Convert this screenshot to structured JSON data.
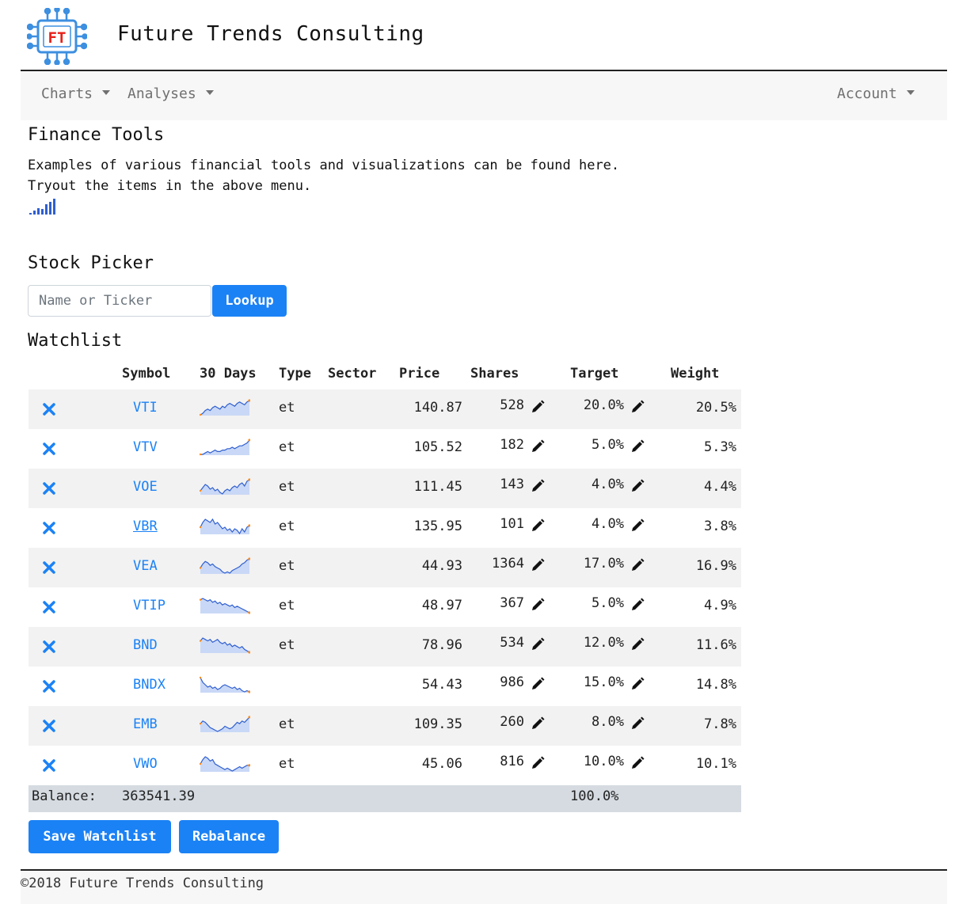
{
  "header": {
    "brand": "Future Trends Consulting",
    "logo_text": "FT"
  },
  "navbar": {
    "charts": "Charts",
    "analyses": "Analyses",
    "account": "Account"
  },
  "intro": {
    "title": "Finance Tools",
    "line1": "Examples of various financial tools and visualizations can be found here.",
    "line2": "Tryout the items in the above menu."
  },
  "picker": {
    "title": "Stock Picker",
    "placeholder": "Name or Ticker",
    "lookup_label": "Lookup"
  },
  "watchlist": {
    "title": "Watchlist",
    "columns": [
      "Symbol",
      "30 Days",
      "Type",
      "Sector",
      "Price",
      "Shares",
      "Target",
      "Weight"
    ],
    "rows": [
      {
        "symbol": "VTI",
        "type": "et",
        "price": "140.87",
        "shares": "528",
        "target": "20.0%",
        "weight": "20.5%",
        "spark": [
          5,
          6,
          8,
          9,
          8,
          10,
          11,
          10,
          9,
          11,
          10,
          12,
          13,
          12,
          11,
          13,
          14,
          13,
          12,
          14,
          15
        ]
      },
      {
        "symbol": "VTV",
        "type": "et",
        "price": "105.52",
        "shares": "182",
        "target": "5.0%",
        "weight": "5.3%",
        "spark": [
          6,
          6,
          7,
          8,
          7,
          8,
          9,
          8,
          8,
          9,
          9,
          10,
          10,
          11,
          10,
          11,
          12,
          12,
          13,
          14,
          16
        ]
      },
      {
        "symbol": "VOE",
        "type": "et",
        "price": "111.45",
        "shares": "143",
        "target": "4.0%",
        "weight": "4.4%",
        "spark": [
          8,
          10,
          12,
          11,
          9,
          10,
          8,
          9,
          7,
          6,
          8,
          9,
          8,
          10,
          11,
          10,
          12,
          13,
          11,
          14,
          15
        ]
      },
      {
        "symbol": "VBR",
        "type": "et",
        "price": "135.95",
        "shares": "101",
        "target": "4.0%",
        "weight": "3.8%",
        "spark": [
          10,
          13,
          15,
          14,
          13,
          15,
          12,
          13,
          11,
          9,
          10,
          8,
          9,
          7,
          9,
          8,
          6,
          9,
          7,
          10,
          11
        ]
      },
      {
        "symbol": "VEA",
        "type": "et",
        "price": "44.93",
        "shares": "1364",
        "target": "17.0%",
        "weight": "16.9%",
        "spark": [
          9,
          12,
          14,
          13,
          11,
          12,
          10,
          9,
          8,
          6,
          5,
          6,
          5,
          7,
          8,
          9,
          10,
          12,
          13,
          15,
          16
        ]
      },
      {
        "symbol": "VTIP",
        "type": "et",
        "price": "48.97",
        "shares": "367",
        "target": "5.0%",
        "weight": "4.9%",
        "spark": [
          14,
          15,
          14,
          13,
          14,
          12,
          13,
          11,
          12,
          10,
          11,
          10,
          9,
          10,
          8,
          9,
          8,
          7,
          6,
          5,
          4
        ]
      },
      {
        "symbol": "BND",
        "type": "et",
        "price": "78.96",
        "shares": "534",
        "target": "12.0%",
        "weight": "11.6%",
        "spark": [
          12,
          14,
          13,
          12,
          13,
          11,
          12,
          13,
          11,
          10,
          11,
          9,
          10,
          8,
          9,
          8,
          7,
          8,
          6,
          5,
          4
        ]
      },
      {
        "symbol": "BNDX",
        "type": "",
        "price": "54.43",
        "shares": "986",
        "target": "15.0%",
        "weight": "14.8%",
        "spark": [
          16,
          12,
          10,
          8,
          9,
          7,
          8,
          6,
          7,
          9,
          10,
          9,
          8,
          7,
          8,
          6,
          7,
          5,
          4,
          5,
          4
        ]
      },
      {
        "symbol": "EMB",
        "type": "et",
        "price": "109.35",
        "shares": "260",
        "target": "8.0%",
        "weight": "7.8%",
        "spark": [
          11,
          13,
          12,
          10,
          8,
          7,
          6,
          5,
          6,
          7,
          9,
          8,
          7,
          8,
          10,
          12,
          11,
          13,
          12,
          14,
          16
        ]
      },
      {
        "symbol": "VWO",
        "type": "et",
        "price": "45.06",
        "shares": "816",
        "target": "10.0%",
        "weight": "10.1%",
        "spark": [
          10,
          13,
          15,
          14,
          12,
          13,
          10,
          9,
          8,
          7,
          6,
          7,
          6,
          5,
          6,
          7,
          8,
          7,
          8,
          9,
          9
        ]
      }
    ],
    "balance_label": "Balance:",
    "balance_value": "363541.39",
    "target_total": "100.0%",
    "save_label": "Save Watchlist",
    "rebalance_label": "Rebalance"
  },
  "footer": {
    "text": "©2018 Future Trends Consulting"
  },
  "colors": {
    "accent": "#1b82f5",
    "spark_line": "#2f5fd0",
    "spark_fill": "#c9d8f6",
    "spark_end": "#ff8c1a",
    "logo_red": "#e8201a",
    "logo_blue": "#3d8fe0"
  }
}
